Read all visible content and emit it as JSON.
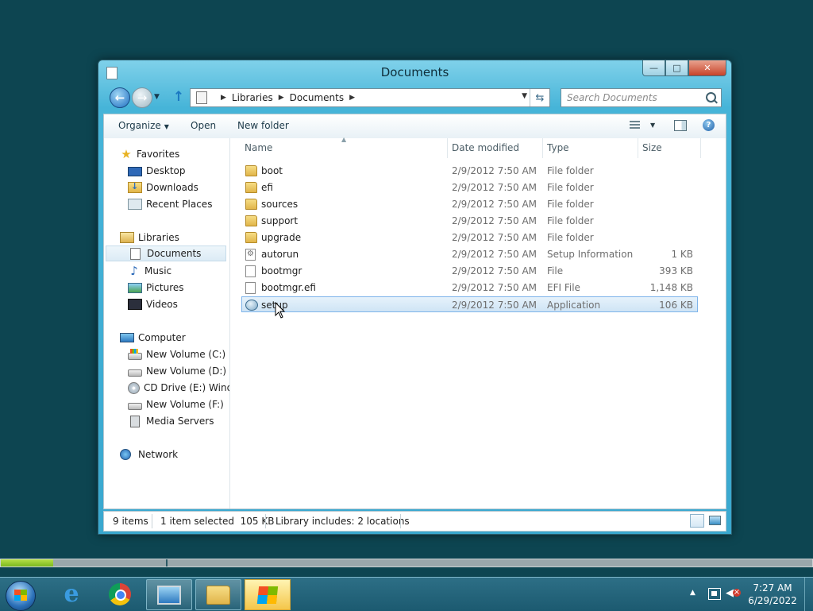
{
  "window": {
    "title": "Documents",
    "controls": {
      "minimize": "—",
      "maximize": "□",
      "close": "✕"
    }
  },
  "address_bar": {
    "breadcrumbs": [
      "Libraries",
      "Documents"
    ],
    "search_placeholder": "Search Documents"
  },
  "toolbar": {
    "organize_label": "Organize",
    "open_label": "Open",
    "new_folder_label": "New folder",
    "help_label": "?"
  },
  "navigation": {
    "favorites": {
      "label": "Favorites",
      "items": [
        {
          "label": "Desktop",
          "icon": "desktop-icon"
        },
        {
          "label": "Downloads",
          "icon": "downloads-icon"
        },
        {
          "label": "Recent Places",
          "icon": "recent-places-icon"
        }
      ]
    },
    "libraries": {
      "label": "Libraries",
      "items": [
        {
          "label": "Documents",
          "icon": "documents-icon",
          "selected": true
        },
        {
          "label": "Music",
          "icon": "music-icon"
        },
        {
          "label": "Pictures",
          "icon": "pictures-icon"
        },
        {
          "label": "Videos",
          "icon": "videos-icon"
        }
      ]
    },
    "computer": {
      "label": "Computer",
      "items": [
        {
          "label": "New Volume (C:)",
          "icon": "system-drive-icon"
        },
        {
          "label": "New Volume (D:)",
          "icon": "drive-icon"
        },
        {
          "label": "CD Drive (E:) Windows",
          "icon": "cd-drive-icon"
        },
        {
          "label": "New Volume (F:)",
          "icon": "drive-icon"
        },
        {
          "label": "Media Servers",
          "icon": "media-server-icon"
        }
      ]
    },
    "network": {
      "label": "Network"
    }
  },
  "columns": {
    "name": "Name",
    "date_modified": "Date modified",
    "type": "Type",
    "size": "Size"
  },
  "files": [
    {
      "name": "boot",
      "date": "2/9/2012 7:50 AM",
      "type": "File folder",
      "size": "",
      "icon": "folder-icon"
    },
    {
      "name": "efi",
      "date": "2/9/2012 7:50 AM",
      "type": "File folder",
      "size": "",
      "icon": "folder-icon"
    },
    {
      "name": "sources",
      "date": "2/9/2012 7:50 AM",
      "type": "File folder",
      "size": "",
      "icon": "folder-icon"
    },
    {
      "name": "support",
      "date": "2/9/2012 7:50 AM",
      "type": "File folder",
      "size": "",
      "icon": "folder-icon"
    },
    {
      "name": "upgrade",
      "date": "2/9/2012 7:50 AM",
      "type": "File folder",
      "size": "",
      "icon": "folder-icon"
    },
    {
      "name": "autorun",
      "date": "2/9/2012 7:50 AM",
      "type": "Setup Information",
      "size": "1 KB",
      "icon": "setup-info-icon"
    },
    {
      "name": "bootmgr",
      "date": "2/9/2012 7:50 AM",
      "type": "File",
      "size": "393 KB",
      "icon": "file-icon"
    },
    {
      "name": "bootmgr.efi",
      "date": "2/9/2012 7:50 AM",
      "type": "EFI File",
      "size": "1,148 KB",
      "icon": "file-icon"
    },
    {
      "name": "setup",
      "date": "2/9/2012 7:50 AM",
      "type": "Application",
      "size": "106 KB",
      "icon": "application-icon",
      "selected": true
    }
  ],
  "status_bar": {
    "item_count": "9 items",
    "selection": "1 item selected  105 KB",
    "library_info": "Library includes: 2 locations"
  },
  "progress": {
    "fraction": 0.065
  },
  "taskbar": {
    "apps": [
      {
        "name": "internet-explorer",
        "icon": "internet-explorer-icon"
      },
      {
        "name": "chrome",
        "icon": "chrome-icon"
      },
      {
        "name": "remote-desktop",
        "icon": "remote-desktop-icon"
      },
      {
        "name": "file-explorer",
        "icon": "file-explorer-icon"
      },
      {
        "name": "windows-setup",
        "icon": "windows-logo-icon",
        "active": true
      }
    ],
    "clock_time": "7:27 AM",
    "clock_date": "6/29/2022"
  }
}
